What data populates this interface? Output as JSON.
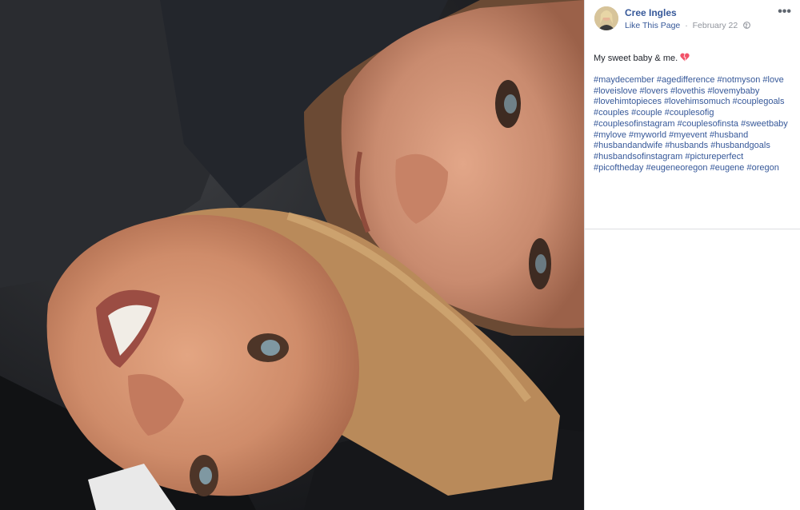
{
  "post": {
    "page_name": "Cree Ingles",
    "like_label": "Like This Page",
    "separator": "·",
    "date": "February 22",
    "audience_icon": "globe-icon",
    "more_label": "•••",
    "caption": "My sweet baby & me.",
    "caption_icon": "heart-icon",
    "hashtags": [
      "#maydecember",
      "#agedifference",
      "#notmyson",
      "#love",
      "#loveislove",
      "#lovers",
      "#lovethis",
      "#lovemybaby",
      "#lovehimtopieces",
      "#lovehimsomuch",
      "#couplegoals",
      "#couples",
      "#couple",
      "#couplesofig",
      "#couplesofinstagram",
      "#couplesofinsta",
      "#sweetbaby",
      "#mylove",
      "#myworld",
      "#myevent",
      "#husband",
      "#husbandandwife",
      "#husbands",
      "#husbandgoals",
      "#husbandsofinstagram",
      "#pictureperfect",
      "#picoftheday",
      "#eugeneoregon",
      "#eugene",
      "#oregon"
    ]
  },
  "colors": {
    "link": "#365899",
    "meta": "#90949c",
    "text": "#1d2129",
    "heart": "#f25268"
  }
}
